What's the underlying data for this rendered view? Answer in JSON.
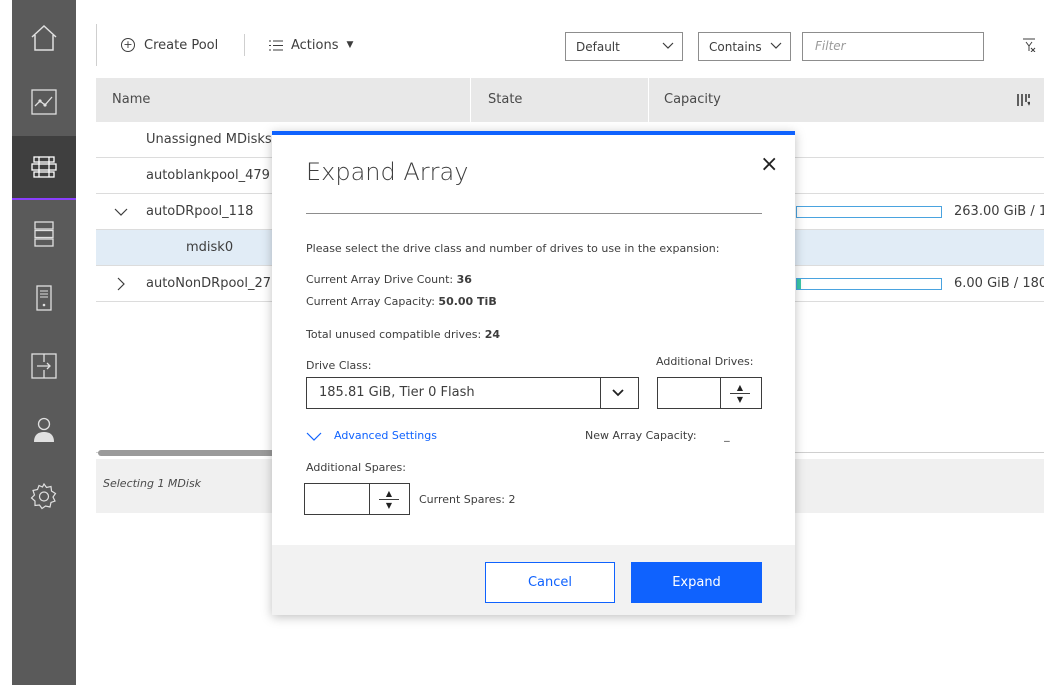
{
  "nav": {
    "items": [
      {
        "icon": "home-icon"
      },
      {
        "icon": "monitoring-icon"
      },
      {
        "icon": "pools-icon",
        "active": true
      },
      {
        "icon": "volumes-icon"
      },
      {
        "icon": "hosts-icon"
      },
      {
        "icon": "copy-services-icon"
      },
      {
        "icon": "access-icon"
      },
      {
        "icon": "settings-icon"
      }
    ]
  },
  "toolbar": {
    "create_label": "Create Pool",
    "actions_label": "Actions",
    "view_select": "Default",
    "match_select": "Contains",
    "filter_placeholder": "Filter"
  },
  "table": {
    "columns": [
      "Name",
      "State",
      "Capacity"
    ],
    "rows": [
      {
        "name": "Unassigned MDisks"
      },
      {
        "name": "autoblankpool_479"
      },
      {
        "name": "autoDRpool_118",
        "expanded": true,
        "capacity": "263.00 GiB / 1.",
        "usage_fraction": 0.0
      },
      {
        "name": "mdisk0",
        "selected": true
      },
      {
        "name": "autoNonDRpool_27",
        "expanded": false,
        "capacity": "6.00 GiB / 180.",
        "usage_fraction": 0.03
      }
    ],
    "status_text": "Selecting 1 MDisk"
  },
  "modal": {
    "title": "Expand Array",
    "close_symbol": "×",
    "instructions": "Please select the drive class and number of drives to use in the expansion:",
    "drive_count_label": "Current Array Drive Count: ",
    "drive_count_value": "36",
    "capacity_label": "Current Array Capacity: ",
    "capacity_value": "50.00 TiB",
    "unused_label": "Total unused compatible drives: ",
    "unused_value": "24",
    "drive_class_label": "Drive Class:",
    "drive_class_value": "185.81 GiB, Tier 0 Flash",
    "additional_drives_label": "Additional Drives:",
    "advanced_label": "Advanced Settings",
    "new_capacity_label": "New Array Capacity:",
    "new_capacity_value": "_",
    "spares_label": "Additional Spares:",
    "current_spares": "Current Spares: 2",
    "cancel_label": "Cancel",
    "expand_label": "Expand"
  },
  "colors": {
    "accent": "#0f62fe",
    "rail": "#5a5a5a",
    "rail_active": "#3f3f3f",
    "selected_row": "#e1ecf6",
    "capacity_fill": "#3ac7a8"
  }
}
